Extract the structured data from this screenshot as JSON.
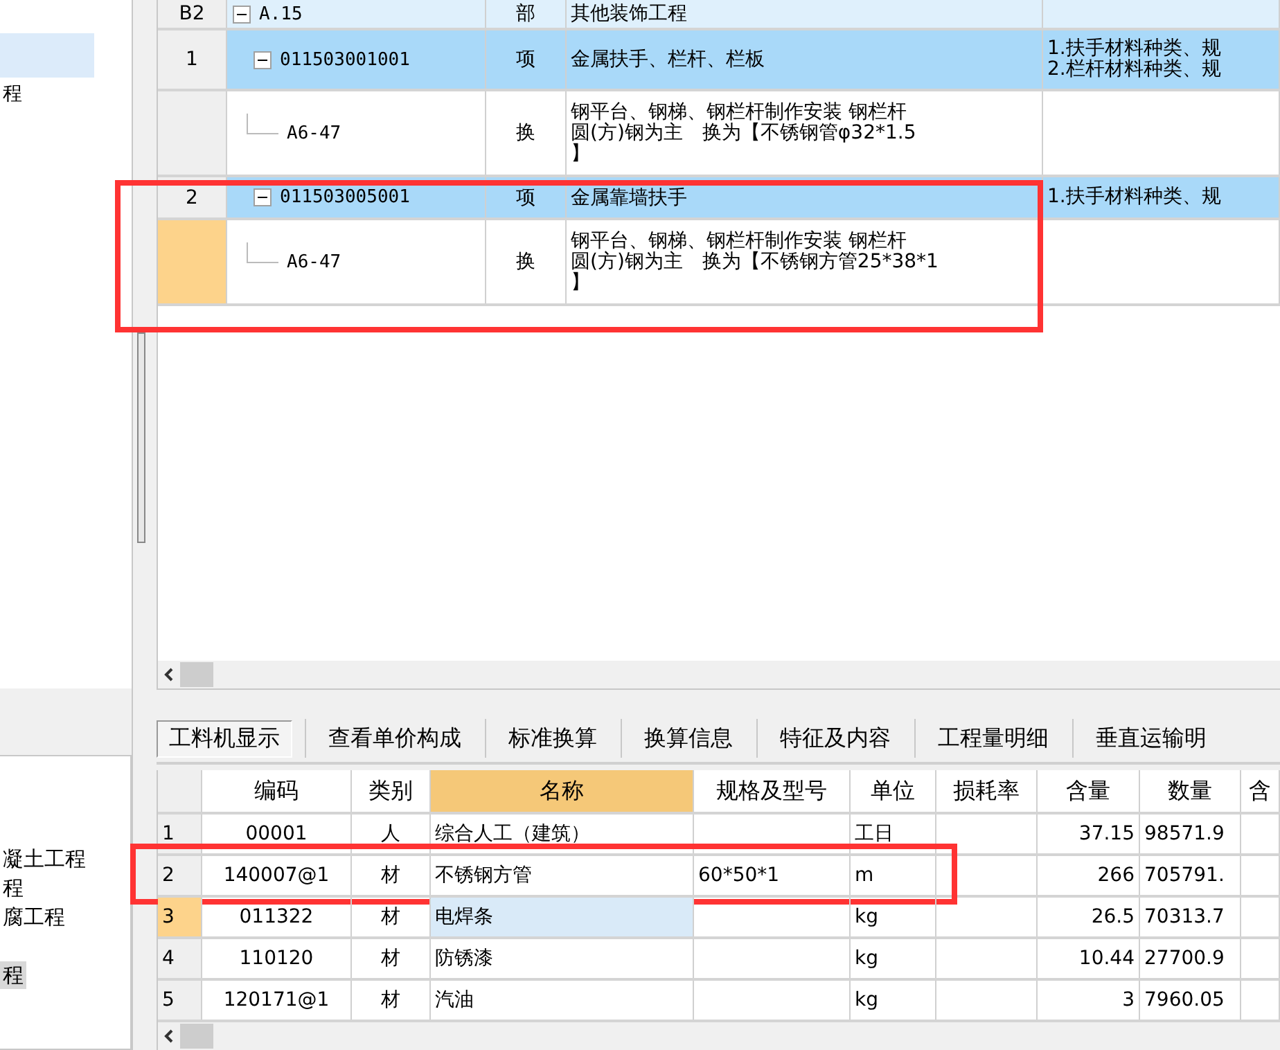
{
  "left_tree": {
    "items": [
      {
        "selected": true
      },
      {
        "label": "程",
        "selected": false
      }
    ]
  },
  "left_list": {
    "items": [
      {
        "label": "凝土工程",
        "selected": false
      },
      {
        "label": "程",
        "selected": false
      },
      {
        "label": "腐工程",
        "selected": false
      },
      {
        "label": "程",
        "selected": true
      }
    ]
  },
  "item_grid": {
    "rows": [
      {
        "number": "B2",
        "code": "A.15",
        "type": "部",
        "name": "其他装饰工程",
        "kind": "section",
        "expanded": true,
        "marked": false,
        "children": [
          {
            "number": "1",
            "code": "011503001001",
            "type": "项",
            "name": "金属扶手、栏杆、栏板",
            "feature_lines": [
              "1.扶手材料种类、规",
              "2.栏杆材料种类、规"
            ],
            "kind": "item",
            "expanded": true,
            "marked": false,
            "children": [
              {
                "number_current": false,
                "code": "A6-47",
                "type": "换",
                "name_lines": [
                  "钢平台、钢梯、钢栏杆制作安装 钢栏杆",
                  "圆(方)钢为主　换为【不锈钢管φ32*1.5",
                  "】"
                ]
              }
            ]
          },
          {
            "number": "2",
            "code": "011503005001",
            "type": "项",
            "name": "金属靠墙扶手",
            "feature_lines": [
              "1.扶手材料种类、规"
            ],
            "kind": "item",
            "expanded": true,
            "marked": true,
            "children": [
              {
                "number_current": true,
                "code": "A6-47",
                "type": "换",
                "name_lines": [
                  "钢平台、钢梯、钢栏杆制作安装 钢栏杆",
                  "圆(方)钢为主　换为【不锈钢方管25*38*1",
                  "】"
                ]
              }
            ]
          }
        ]
      }
    ]
  },
  "tabs": [
    {
      "label": "工料机显示",
      "selected": true
    },
    {
      "label": "查看单价构成",
      "selected": false
    },
    {
      "label": "标准换算",
      "selected": false
    },
    {
      "label": "换算信息",
      "selected": false
    },
    {
      "label": "特征及内容",
      "selected": false
    },
    {
      "label": "工程量明细",
      "selected": false
    },
    {
      "label": "垂直运输明",
      "selected": false
    }
  ],
  "resource_grid": {
    "columns": [
      {
        "label": "编码",
        "selected": false
      },
      {
        "label": "类别",
        "selected": false
      },
      {
        "label": "名称",
        "selected": true
      },
      {
        "label": "规格及型号",
        "selected": false
      },
      {
        "label": "单位",
        "selected": false
      },
      {
        "label": "损耗率",
        "selected": false
      },
      {
        "label": "含量",
        "selected": false
      },
      {
        "label": "数量",
        "selected": false
      },
      {
        "label": "含",
        "selected": false
      }
    ],
    "rows": [
      {
        "number": "1",
        "code": "00001",
        "type": "人",
        "name": "综合人工（建筑）",
        "spec": "",
        "unit": "工日",
        "content": "37.15",
        "quantity": "98571.9",
        "current": false,
        "marked": false
      },
      {
        "number": "2",
        "code": "140007@1",
        "type": "材",
        "name": "不锈钢方管",
        "spec": "60*50*1",
        "unit": "m",
        "content": "266",
        "quantity": "705791.",
        "current": false,
        "marked": true
      },
      {
        "number": "3",
        "code": "011322",
        "type": "材",
        "name": "电焊条",
        "spec": "",
        "unit": "kg",
        "content": "26.5",
        "quantity": "70313.7",
        "current": true,
        "marked": false
      },
      {
        "number": "4",
        "code": "110120",
        "type": "材",
        "name": "防锈漆",
        "spec": "",
        "unit": "kg",
        "content": "10.44",
        "quantity": "27700.9",
        "current": false,
        "marked": false
      },
      {
        "number": "5",
        "code": "120171@1",
        "type": "材",
        "name": "汽油",
        "spec": "",
        "unit": "kg",
        "content": "3",
        "quantity": "7960.05",
        "current": false,
        "marked": false
      }
    ]
  }
}
